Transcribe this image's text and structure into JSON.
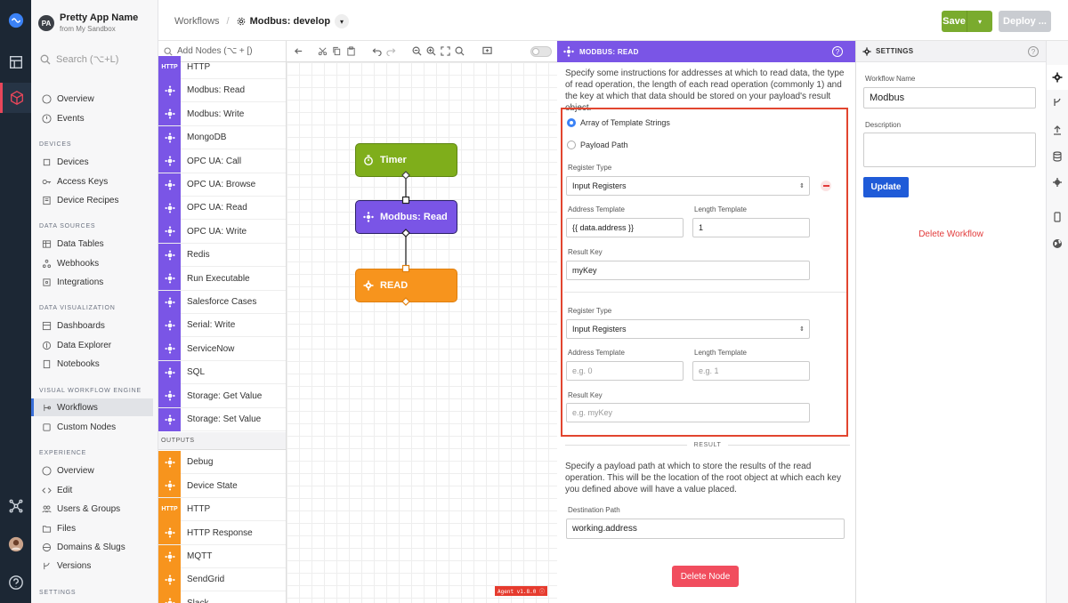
{
  "app": {
    "avatar": "PA",
    "name": "Pretty App Name",
    "subtitle": "from My Sandbox"
  },
  "sidebar": {
    "search_placeholder": "Search (⌥+L)",
    "top_items": [
      {
        "label": "Overview"
      },
      {
        "label": "Events"
      }
    ],
    "sections": [
      {
        "title": "DEVICES",
        "items": [
          {
            "label": "Devices"
          },
          {
            "label": "Access Keys"
          },
          {
            "label": "Device Recipes"
          }
        ]
      },
      {
        "title": "DATA SOURCES",
        "items": [
          {
            "label": "Data Tables"
          },
          {
            "label": "Webhooks"
          },
          {
            "label": "Integrations"
          }
        ]
      },
      {
        "title": "DATA VISUALIZATION",
        "items": [
          {
            "label": "Dashboards"
          },
          {
            "label": "Data Explorer"
          },
          {
            "label": "Notebooks"
          }
        ]
      },
      {
        "title": "VISUAL WORKFLOW ENGINE",
        "items": [
          {
            "label": "Workflows"
          },
          {
            "label": "Custom Nodes"
          }
        ]
      },
      {
        "title": "EXPERIENCE",
        "items": [
          {
            "label": "Overview"
          },
          {
            "label": "Edit"
          },
          {
            "label": "Users & Groups"
          },
          {
            "label": "Files"
          },
          {
            "label": "Domains & Slugs"
          },
          {
            "label": "Versions"
          }
        ]
      },
      {
        "title": "SETTINGS",
        "items": []
      }
    ]
  },
  "topbar": {
    "breadcrumb_root": "Workflows",
    "breadcrumb_current": "Modbus: develop",
    "save_label": "Save",
    "deploy_label": "Deploy ..."
  },
  "palette": {
    "search_placeholder": "Add Nodes (⌥ + [)",
    "items": [
      {
        "label": "HTTP",
        "color": "#7a55e6",
        "icon": "http-icon",
        "glyph": "HTTP"
      },
      {
        "label": "Modbus: Read",
        "color": "#7a55e6",
        "icon": "modbus-icon",
        "glyph": ""
      },
      {
        "label": "Modbus: Write",
        "color": "#7a55e6",
        "icon": "modbus-icon",
        "glyph": ""
      },
      {
        "label": "MongoDB",
        "color": "#7a55e6",
        "icon": "mongodb-icon",
        "glyph": ""
      },
      {
        "label": "OPC UA: Call",
        "color": "#7a55e6",
        "icon": "cloud-icon",
        "glyph": ""
      },
      {
        "label": "OPC UA: Browse",
        "color": "#7a55e6",
        "icon": "cloud-icon",
        "glyph": ""
      },
      {
        "label": "OPC UA: Read",
        "color": "#7a55e6",
        "icon": "cloud-icon",
        "glyph": ""
      },
      {
        "label": "OPC UA: Write",
        "color": "#7a55e6",
        "icon": "cloud-icon",
        "glyph": ""
      },
      {
        "label": "Redis",
        "color": "#7a55e6",
        "icon": "redis-icon",
        "glyph": ""
      },
      {
        "label": "Run Executable",
        "color": "#7a55e6",
        "icon": "terminal-icon",
        "glyph": ""
      },
      {
        "label": "Salesforce Cases",
        "color": "#7a55e6",
        "icon": "salesforce-icon",
        "glyph": ""
      },
      {
        "label": "Serial: Write",
        "color": "#7a55e6",
        "icon": "serial-icon",
        "glyph": ""
      },
      {
        "label": "ServiceNow",
        "color": "#7a55e6",
        "icon": "servicenow-icon",
        "glyph": ""
      },
      {
        "label": "SQL",
        "color": "#7a55e6",
        "icon": "database-icon",
        "glyph": ""
      },
      {
        "label": "Storage: Get Value",
        "color": "#7a55e6",
        "icon": "cloud-download-icon",
        "glyph": ""
      },
      {
        "label": "Storage: Set Value",
        "color": "#7a55e6",
        "icon": "cloud-upload-icon",
        "glyph": ""
      }
    ],
    "outputs_title": "OUTPUTS",
    "outputs": [
      {
        "label": "Debug",
        "color": "#f7941d",
        "icon": "bug-icon",
        "glyph": ""
      },
      {
        "label": "Device State",
        "color": "#f7941d",
        "icon": "gear-icon",
        "glyph": ""
      },
      {
        "label": "HTTP",
        "color": "#f7941d",
        "icon": "http-icon",
        "glyph": "HTTP"
      },
      {
        "label": "HTTP Response",
        "color": "#f7941d",
        "icon": "link-icon",
        "glyph": ""
      },
      {
        "label": "MQTT",
        "color": "#f7941d",
        "icon": "mqtt-icon",
        "glyph": ""
      },
      {
        "label": "SendGrid",
        "color": "#f7941d",
        "icon": "sendgrid-icon",
        "glyph": ""
      },
      {
        "label": "Slack",
        "color": "#f7941d",
        "icon": "slack-icon",
        "glyph": ""
      }
    ]
  },
  "canvas": {
    "nodes": [
      {
        "label": "Timer",
        "color": "#7fae1b",
        "border": "#5e8512",
        "icon": "timer-icon"
      },
      {
        "label": "Modbus: Read",
        "color": "#7a55e6",
        "border": "#2a1f66",
        "icon": "modbus-icon"
      },
      {
        "label": "READ",
        "color": "#f7941d",
        "border": "#e07f0e",
        "icon": "gear-icon"
      }
    ],
    "agent_tag": "Agent v1.8.0 ⓘ"
  },
  "node_config": {
    "title": "MODBUS: READ",
    "help": "?",
    "description": "Specify some instructions for addresses at which to read data, the type of read operation, the length of each read operation (commonly 1) and the key at which that data should be stored on your payload's result object.",
    "mode_options": [
      "Array of Template Strings",
      "Payload Path"
    ],
    "register_type_label": "Register Type",
    "address_label": "Address Template",
    "length_label": "Length Template",
    "result_key_label": "Result Key",
    "rows": [
      {
        "register_type": "Input Registers",
        "address": "{{ data.address }}",
        "length": "1",
        "result_key": "myKey"
      },
      {
        "register_type": "Input Registers",
        "address_placeholder": "e.g. 0",
        "length_placeholder": "e.g. 1",
        "result_key_placeholder": "e.g. myKey"
      }
    ],
    "result_title": "RESULT",
    "result_description": "Specify a payload path at which to store the results of the read operation. This will be the location of the root object at which each key you defined above will have a value placed.",
    "destination_label": "Destination Path",
    "destination_value": "working.address",
    "delete_label": "Delete Node"
  },
  "settings": {
    "title": "SETTINGS",
    "help": "?",
    "name_label": "Workflow Name",
    "name_value": "Modbus",
    "description_label": "Description",
    "update_label": "Update",
    "delete_label": "Delete Workflow"
  }
}
